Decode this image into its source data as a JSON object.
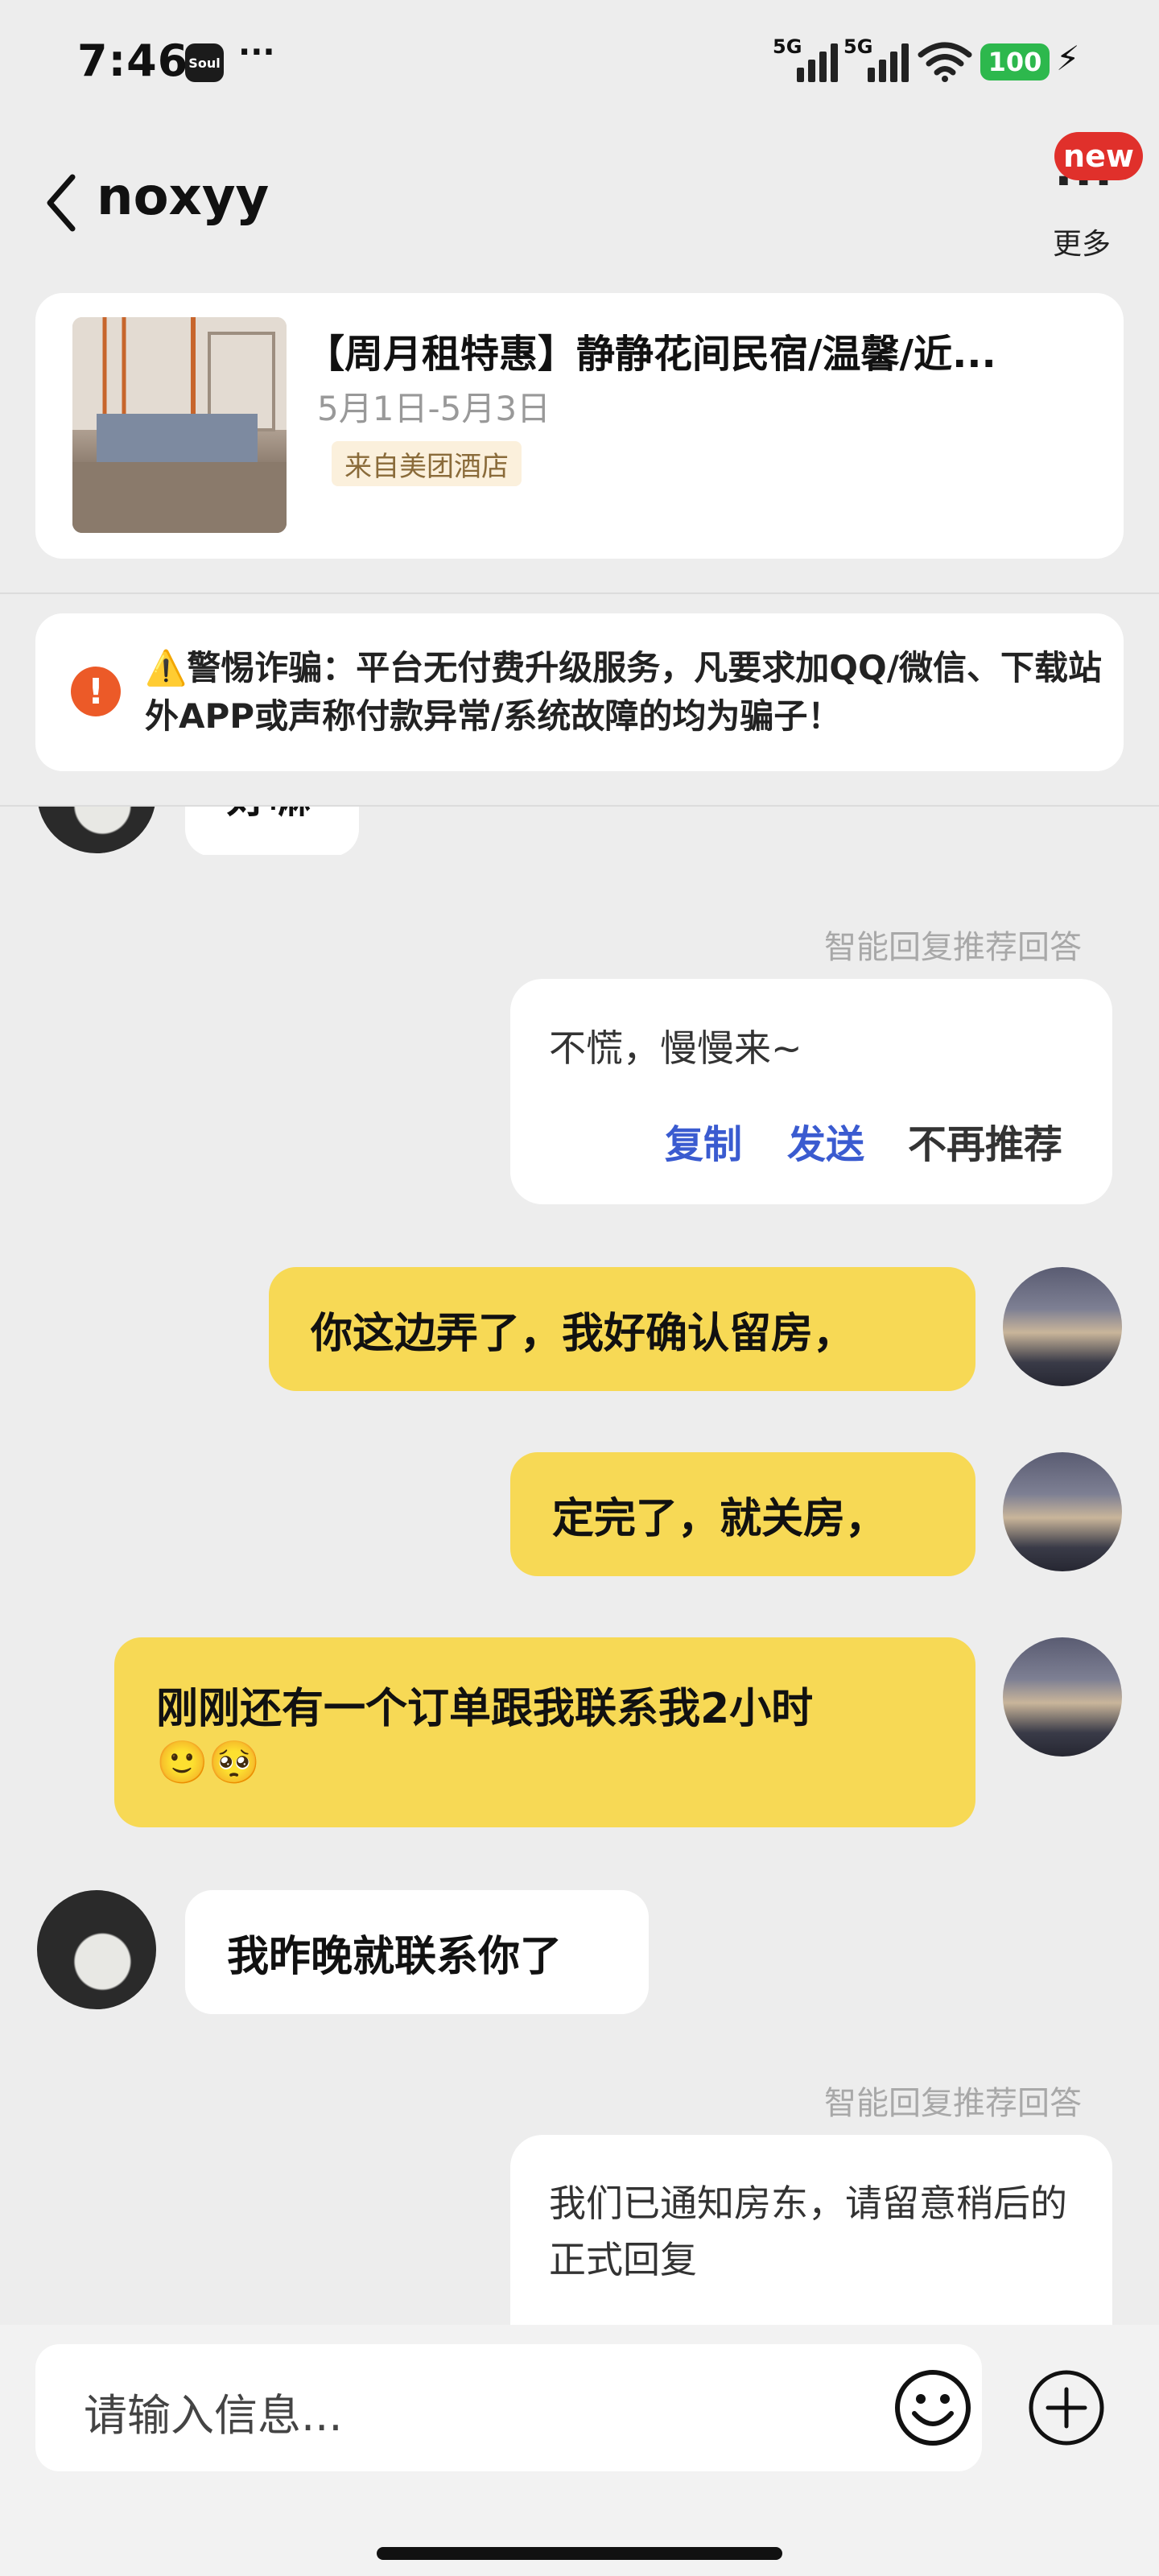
{
  "status_bar": {
    "time": "7:46",
    "app_icon": "Soul",
    "more": "···",
    "signal1": "5G",
    "signal2": "5G",
    "battery": "100"
  },
  "header": {
    "contact_name": "noxyy",
    "new_badge": "new",
    "more_label": "更多"
  },
  "listing": {
    "title": "【周月租特惠】静静花间民宿/温馨/近...",
    "dates": "5月1日-5月3日",
    "source": "来自美团酒店"
  },
  "warning": {
    "text": "⚠️警惕诈骗：平台无付费升级服务，凡要求加QQ/微信、下载站外APP或声称付款异常/系统故障的均为骗子！"
  },
  "messages": {
    "partial_other": "好嘛",
    "smart_label_1": "智能回复推荐回答",
    "suggest1": {
      "text": "不慌，慢慢来~",
      "copy": "复制",
      "send": "发送",
      "dismiss": "不再推荐"
    },
    "self1": "你这边弄了，我好确认留房，",
    "self2": "定完了，就关房，",
    "self3": "刚刚还有一个订单跟我联系我2小时",
    "self3_emoji": "🙂🥺",
    "other1": "我昨晚就联系你了",
    "smart_label_2": "智能回复推荐回答",
    "suggest2": {
      "text": "我们已通知房东，请留意稍后的正式回复"
    }
  },
  "input": {
    "placeholder": "请输入信息..."
  },
  "colors": {
    "accent_blue": "#3a5bd0",
    "bubble_yellow": "#f7d955",
    "warning_orange": "#ec5a28",
    "badge_red": "#e0302b"
  }
}
